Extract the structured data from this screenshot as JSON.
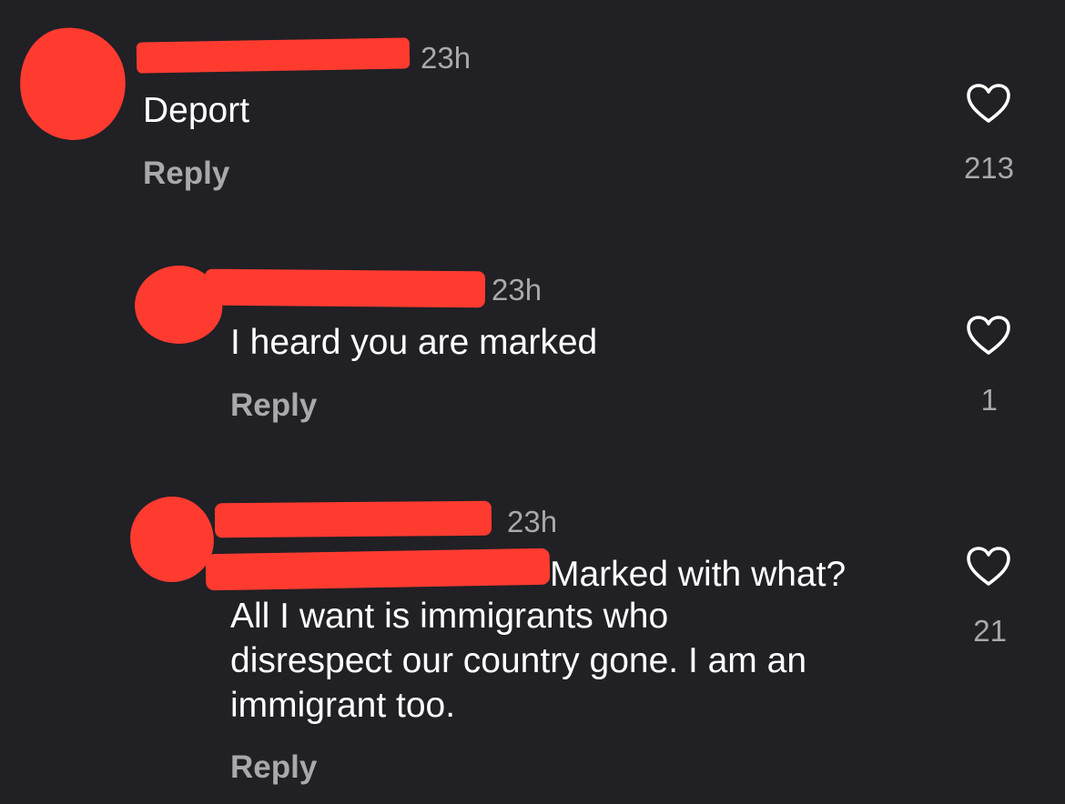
{
  "comments": [
    {
      "time": "23h",
      "text": "Deport",
      "reply_label": "Reply",
      "like_count": "213",
      "like_icon": "heart-outline-icon"
    },
    {
      "time": "23h",
      "text": "I heard you are marked",
      "reply_label": "Reply",
      "like_count": "1",
      "like_icon": "heart-outline-icon"
    },
    {
      "time": "23h",
      "text_lines": [
        "Marked with what?",
        "All I want is immigrants who",
        "disrespect our country gone. I am an",
        "immigrant too."
      ],
      "reply_label": "Reply",
      "like_count": "21",
      "like_icon": "heart-outline-icon"
    }
  ],
  "colors": {
    "background": "#202025",
    "redaction": "#ff3b30",
    "secondary_text": "#a8a8ad"
  }
}
